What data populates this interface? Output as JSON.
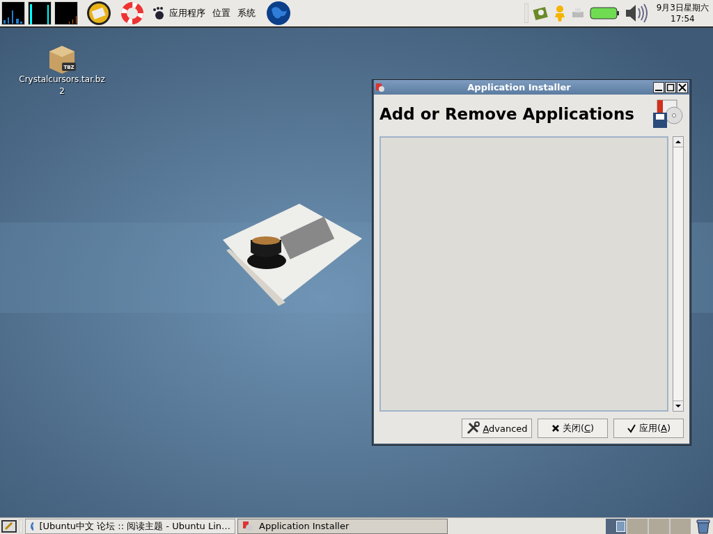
{
  "top_panel": {
    "menus": [
      "应用程序",
      "位置",
      "系统"
    ],
    "clock": {
      "date": "9月3日星期六",
      "time": "17:54"
    }
  },
  "desktop_icons": [
    {
      "label": "Crystalcursors.tar.bz2",
      "badge": "TBZ"
    }
  ],
  "window": {
    "title": "Application Installer",
    "heading": "Add or Remove Applications",
    "buttons": [
      {
        "kind": "tools",
        "access_key": "A",
        "after": "dvanced"
      },
      {
        "kind": "close",
        "before": "关闭(",
        "access_key": "C",
        "after": ")"
      },
      {
        "kind": "apply",
        "before": "应用(",
        "access_key": "A",
        "after": ")"
      }
    ]
  },
  "taskbar": {
    "tasks": [
      {
        "label": "[Ubuntu中文 论坛 :: 阅读主题 - Ubuntu Lin…",
        "kind": "browser",
        "selected": false
      },
      {
        "label": "Application Installer",
        "kind": "installer",
        "selected": true
      }
    ],
    "workspaces": [
      {
        "selected": true
      },
      {
        "selected": false
      },
      {
        "selected": false
      },
      {
        "selected": false
      }
    ]
  }
}
